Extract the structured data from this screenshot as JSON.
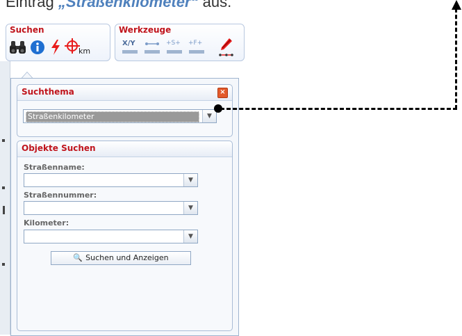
{
  "caption": {
    "prefix": "Eintrag ",
    "highlight": "„Straßenkilometer“",
    "suffix": " aus."
  },
  "toolbar": {
    "suchen_title": "Suchen",
    "werkzeuge_title": "Werkzeuge",
    "km_label": "km",
    "xy_label": "X/Y",
    "s_label": "+S+",
    "f_label": "+F+"
  },
  "suchthema": {
    "title": "Suchthema",
    "close_symbol": "×",
    "selected": "Straßenkilometer"
  },
  "objekte": {
    "title": "Objekte Suchen",
    "fields": [
      {
        "label": "Straßenname:",
        "value": ""
      },
      {
        "label": "Straßennummer:",
        "value": ""
      },
      {
        "label": "Kilometer:",
        "value": ""
      }
    ],
    "button_label": "Suchen und Anzeigen"
  },
  "icons": {
    "binoculars": "binoculars-icon",
    "info": "info-icon",
    "lightning": "lightning-icon",
    "target_km": "target-km-icon",
    "coordinates": "coordinates-icon",
    "measure_distance": "measure-distance-icon",
    "measure_s": "measure-s-icon",
    "measure_f": "measure-f-icon",
    "pen": "pen-icon",
    "magnifier": "magnifier-icon"
  },
  "colors": {
    "accent_red": "#c0141c",
    "panel_border": "#9fb4cf",
    "highlight_blue": "#4f81bd"
  }
}
